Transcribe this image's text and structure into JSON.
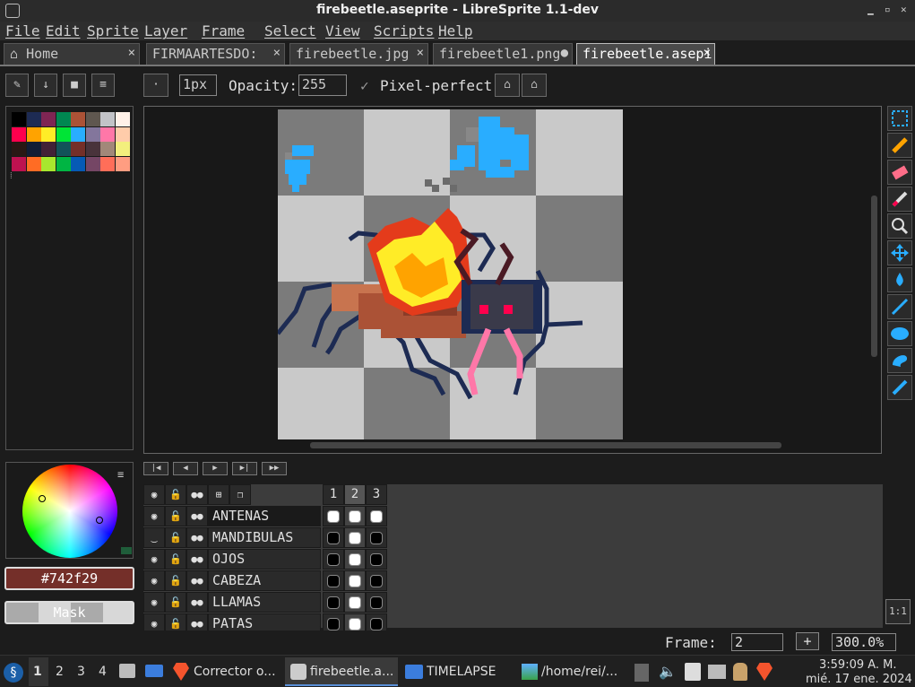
{
  "window": {
    "title": "firebeetle.aseprite - LibreSprite 1.1-dev"
  },
  "menu": [
    "File",
    "Edit",
    "Sprite",
    "Layer",
    "Frame",
    "Select",
    "View",
    "Scripts",
    "Help"
  ],
  "tabs": [
    {
      "label": "Home",
      "icon": "home-icon",
      "close": "×"
    },
    {
      "label": "FIRMAARTESDO:",
      "close": "×"
    },
    {
      "label": "firebeetle.jpg",
      "close": "×"
    },
    {
      "label": "firebeetle1.png",
      "close": "●"
    },
    {
      "label": "firebeetle.asepi",
      "close": "×",
      "active": true
    }
  ],
  "context": {
    "brush_size": "1px",
    "opacity_label": "Opacity:",
    "opacity_value": "255",
    "pixel_perfect_label": "Pixel-perfect",
    "pixel_perfect_check": "✓"
  },
  "palette": {
    "colors": [
      "#000000",
      "#1d2b53",
      "#7e2553",
      "#008751",
      "#ab5236",
      "#5f574f",
      "#c2c3c7",
      "#fff1e8",
      "#ff004d",
      "#ffa300",
      "#ffec27",
      "#00e436",
      "#29adff",
      "#83769c",
      "#ff77a8",
      "#ffccaa",
      "#291814",
      "#111d35",
      "#422136",
      "#125359",
      "#742f29",
      "#49333b",
      "#a28879",
      "#f3ef7d",
      "#be1250",
      "#ff6c24",
      "#a8e72e",
      "#00b543",
      "#065ab5",
      "#754665",
      "#ff6e59",
      "#ff9d81"
    ]
  },
  "current_color": {
    "hex": "#742f29",
    "color": "#742f29"
  },
  "mask_label": "Mask",
  "timeline": {
    "frames": [
      "1",
      "2",
      "3"
    ],
    "active_frame": "2",
    "layers": [
      {
        "name": "ANTENAS",
        "visible": true,
        "selected": true
      },
      {
        "name": "MANDIBULAS",
        "visible": false
      },
      {
        "name": "OJOS",
        "visible": true
      },
      {
        "name": "CABEZA",
        "visible": true
      },
      {
        "name": "LLAMAS",
        "visible": true
      },
      {
        "name": "PATAS",
        "visible": true
      }
    ]
  },
  "status": {
    "frame_label": "Frame:",
    "frame_value": "2",
    "add_frame": "+",
    "zoom": "300.0%",
    "one_to_one": "1:1"
  },
  "taskbar": {
    "workspaces": [
      "1",
      "2",
      "3",
      "4"
    ],
    "apps": [
      {
        "label": "Corrector o...",
        "icon": "brave-icon"
      },
      {
        "label": "firebeetle.a...",
        "icon": "libresprite-icon",
        "active": true
      },
      {
        "label": "TIMELAPSE",
        "icon": "folder-icon"
      },
      {
        "label": "/home/rei/...",
        "icon": "image-viewer-icon"
      }
    ],
    "time": "3:59:09 A. M.",
    "date": "mié. 17 ene. 2024"
  }
}
